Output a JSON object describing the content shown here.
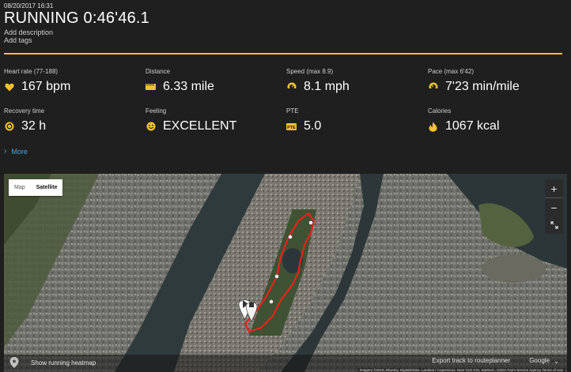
{
  "header": {
    "timestamp": "08/20/2017 16:31",
    "sport": "RUNNING",
    "duration": "0:46'46.1",
    "add_description": "Add description",
    "add_tags": "Add tags"
  },
  "stats": [
    {
      "label": "Heart rate",
      "detail": "(77-188)",
      "value": "167 bpm",
      "icon": "heart-icon"
    },
    {
      "label": "Distance",
      "detail": "",
      "value": "6.33 mile",
      "icon": "ruler-icon"
    },
    {
      "label": "Speed",
      "detail": "(max  8.9)",
      "value": "8.1 mph",
      "icon": "speedometer-icon"
    },
    {
      "label": "Pace",
      "detail": "(max  6'42)",
      "value": "7'23 min/mile",
      "icon": "speedometer-icon"
    },
    {
      "label": "Recovery time",
      "detail": "",
      "value": "32 h",
      "icon": "recovery-icon"
    },
    {
      "label": "Feeling",
      "detail": "",
      "value": "EXCELLENT",
      "icon": "smiley-icon"
    },
    {
      "label": "PTE",
      "detail": "",
      "value": "5.0",
      "icon": "pte-icon"
    },
    {
      "label": "Calories",
      "detail": "",
      "value": "1067 kcal",
      "icon": "flame-icon"
    }
  ],
  "more_label": "More",
  "map": {
    "type_options": [
      "Map",
      "Satellite"
    ],
    "selected_type": "Satellite",
    "zoom_in": "+",
    "zoom_out": "−",
    "heatmap_label": "Show running heatmap",
    "export_label": "Export track to routeplanner",
    "provider": "Google",
    "attribution": "Imagery ©2018, Bluesky, DigitalGlobe, Landsat / Copernicus, New York GIS, Sanborn, USDA Farm Service Agency   Terms of Use"
  },
  "colors": {
    "accent": "#f2c230",
    "background": "#1f1f1f",
    "link": "#4aa8e0",
    "route": "#e8221c"
  }
}
